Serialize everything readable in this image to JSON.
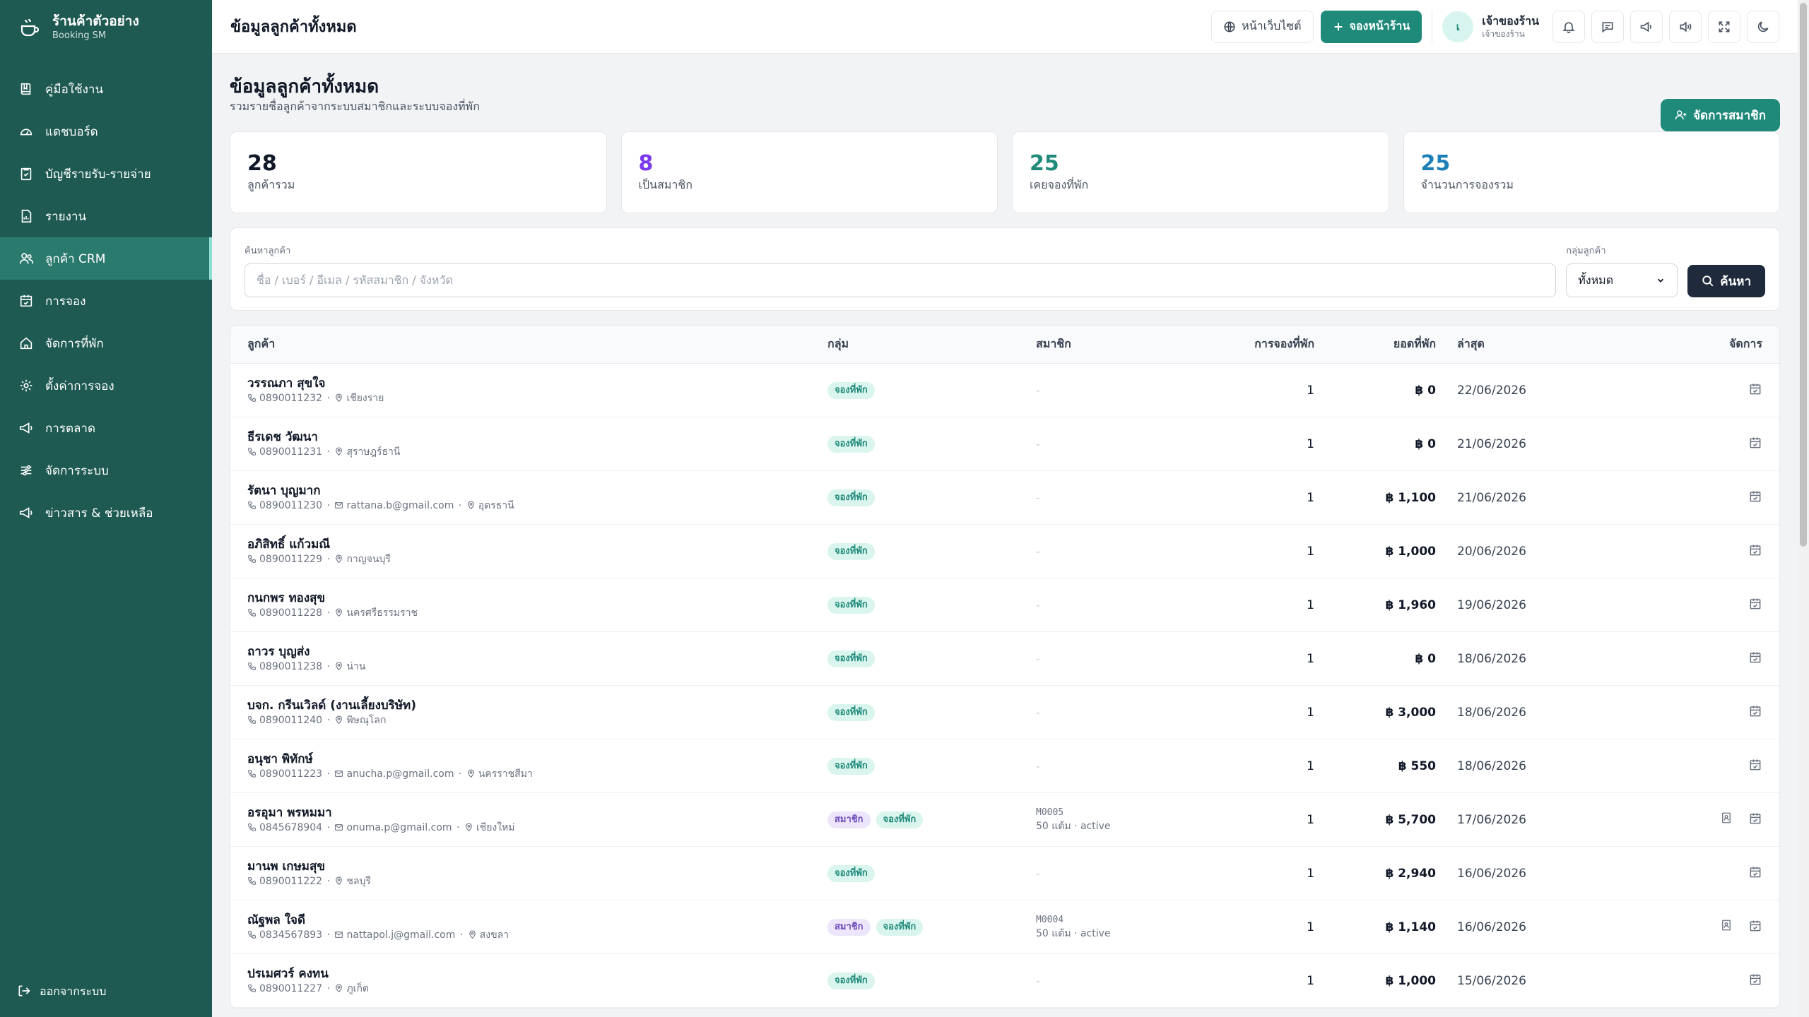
{
  "sidebar": {
    "brand_name": "ร้านค้าตัวอย่าง",
    "brand_sub": "Booking SM",
    "items": [
      {
        "label": "คู่มือใช้งาน",
        "icon": "book-icon"
      },
      {
        "label": "แดชบอร์ด",
        "icon": "gauge-icon"
      },
      {
        "label": "บัญชีรายรับ-รายจ่าย",
        "icon": "ledger-icon"
      },
      {
        "label": "รายงาน",
        "icon": "report-icon"
      },
      {
        "label": "ลูกค้า CRM",
        "icon": "users-icon"
      },
      {
        "label": "การจอง",
        "icon": "calendar-icon"
      },
      {
        "label": "จัดการที่พัก",
        "icon": "house-icon"
      },
      {
        "label": "ตั้งค่าการจอง",
        "icon": "gear-icon"
      },
      {
        "label": "การตลาด",
        "icon": "megaphone-icon"
      },
      {
        "label": "จัดการระบบ",
        "icon": "sliders-icon"
      },
      {
        "label": "ข่าวสาร & ช่วยเหลือ",
        "icon": "megaphone-icon"
      }
    ],
    "active_index": 4,
    "logout_label": "ออกจากระบบ"
  },
  "topbar": {
    "title": "ข้อมูลลูกค้าทั้งหมด",
    "website_label": "หน้าเว็บไซต์",
    "book_label": "จองหน้าร้าน",
    "user_initial": "เ",
    "user_name": "เจ้าของร้าน",
    "user_role": "เจ้าของร้าน"
  },
  "page": {
    "title": "ข้อมูลลูกค้าทั้งหมด",
    "subtitle": "รวมรายชื่อลูกค้าจากระบบสมาชิกและระบบจองที่พัก",
    "manage_label": "จัดการสมาชิก"
  },
  "stats": [
    {
      "value": "28",
      "label": "ลูกค้ารวม",
      "color": "#111827"
    },
    {
      "value": "8",
      "label": "เป็นสมาชิก",
      "color": "#7c3aed"
    },
    {
      "value": "25",
      "label": "เคยจองที่พัก",
      "color": "#1f8a7a"
    },
    {
      "value": "25",
      "label": "จำนวนการจองรวม",
      "color": "#1d7fb8"
    }
  ],
  "search": {
    "label": "ค้นหาลูกค้า",
    "placeholder": "ชื่อ / เบอร์ / อีเมล / รหัสสมาชิก / จังหวัด",
    "group_label": "กลุ่มลูกค้า",
    "group_value": "ทั้งหมด",
    "button_label": "ค้นหา"
  },
  "table": {
    "headers": {
      "customer": "ลูกค้า",
      "group": "กลุ่ม",
      "member": "สมาชิก",
      "bookings": "การจองที่พัก",
      "spent": "ยอดที่พัก",
      "last": "ล่าสุด",
      "actions": "จัดการ"
    },
    "rows": [
      {
        "name": "วรรณภา สุขใจ",
        "phone": "0890011232",
        "email": "",
        "province": "เชียงราย",
        "groups": [
          "จองที่พัก"
        ],
        "member_code": "",
        "member_info": "",
        "bookings": "1",
        "spent": "฿ 0",
        "last": "22/06/2026",
        "has_member_action": false
      },
      {
        "name": "ธีรเดช วัฒนา",
        "phone": "0890011231",
        "email": "",
        "province": "สุราษฎร์ธานี",
        "groups": [
          "จองที่พัก"
        ],
        "member_code": "",
        "member_info": "",
        "bookings": "1",
        "spent": "฿ 0",
        "last": "21/06/2026",
        "has_member_action": false
      },
      {
        "name": "รัตนา บุญมาก",
        "phone": "0890011230",
        "email": "rattana.b@gmail.com",
        "province": "อุดรธานี",
        "groups": [
          "จองที่พัก"
        ],
        "member_code": "",
        "member_info": "",
        "bookings": "1",
        "spent": "฿ 1,100",
        "last": "21/06/2026",
        "has_member_action": false
      },
      {
        "name": "อภิสิทธิ์ แก้วมณี",
        "phone": "0890011229",
        "email": "",
        "province": "กาญจนบุรี",
        "groups": [
          "จองที่พัก"
        ],
        "member_code": "",
        "member_info": "",
        "bookings": "1",
        "spent": "฿ 1,000",
        "last": "20/06/2026",
        "has_member_action": false
      },
      {
        "name": "กนกพร ทองสุข",
        "phone": "0890011228",
        "email": "",
        "province": "นครศรีธรรมราช",
        "groups": [
          "จองที่พัก"
        ],
        "member_code": "",
        "member_info": "",
        "bookings": "1",
        "spent": "฿ 1,960",
        "last": "19/06/2026",
        "has_member_action": false
      },
      {
        "name": "ถาวร บุญส่ง",
        "phone": "0890011238",
        "email": "",
        "province": "น่าน",
        "groups": [
          "จองที่พัก"
        ],
        "member_code": "",
        "member_info": "",
        "bookings": "1",
        "spent": "฿ 0",
        "last": "18/06/2026",
        "has_member_action": false
      },
      {
        "name": "บจก. กรีนเวิลด์ (งานเลี้ยงบริษัท)",
        "phone": "0890011240",
        "email": "",
        "province": "พิษณุโลก",
        "groups": [
          "จองที่พัก"
        ],
        "member_code": "",
        "member_info": "",
        "bookings": "1",
        "spent": "฿ 3,000",
        "last": "18/06/2026",
        "has_member_action": false
      },
      {
        "name": "อนุชา พิทักษ์",
        "phone": "0890011223",
        "email": "anucha.p@gmail.com",
        "province": "นครราชสีมา",
        "groups": [
          "จองที่พัก"
        ],
        "member_code": "",
        "member_info": "",
        "bookings": "1",
        "spent": "฿ 550",
        "last": "18/06/2026",
        "has_member_action": false
      },
      {
        "name": "อรอุมา พรหมมา",
        "phone": "0845678904",
        "email": "onuma.p@gmail.com",
        "province": "เชียงใหม่",
        "groups": [
          "สมาชิก",
          "จองที่พัก"
        ],
        "member_code": "M0005",
        "member_info": "50 แต้ม · active",
        "bookings": "1",
        "spent": "฿ 5,700",
        "last": "17/06/2026",
        "has_member_action": true
      },
      {
        "name": "มานพ เกษมสุข",
        "phone": "0890011222",
        "email": "",
        "province": "ชลบุรี",
        "groups": [
          "จองที่พัก"
        ],
        "member_code": "",
        "member_info": "",
        "bookings": "1",
        "spent": "฿ 2,940",
        "last": "16/06/2026",
        "has_member_action": false
      },
      {
        "name": "ณัฐพล ใจดี",
        "phone": "0834567893",
        "email": "nattapol.j@gmail.com",
        "province": "สงขลา",
        "groups": [
          "สมาชิก",
          "จองที่พัก"
        ],
        "member_code": "M0004",
        "member_info": "50 แต้ม · active",
        "bookings": "1",
        "spent": "฿ 1,140",
        "last": "16/06/2026",
        "has_member_action": true
      },
      {
        "name": "ปรเมศวร์ คงทน",
        "phone": "0890011227",
        "email": "",
        "province": "ภูเก็ต",
        "groups": [
          "จองที่พัก"
        ],
        "member_code": "",
        "member_info": "",
        "bookings": "1",
        "spent": "฿ 1,000",
        "last": "15/06/2026",
        "has_member_action": false
      }
    ],
    "empty_member": "-"
  },
  "colors": {
    "sidebar": "#1e5a52",
    "sidebar_active": "#2a7a6e",
    "primary": "#1f8a7a",
    "dark_button": "#1f2a3c"
  }
}
